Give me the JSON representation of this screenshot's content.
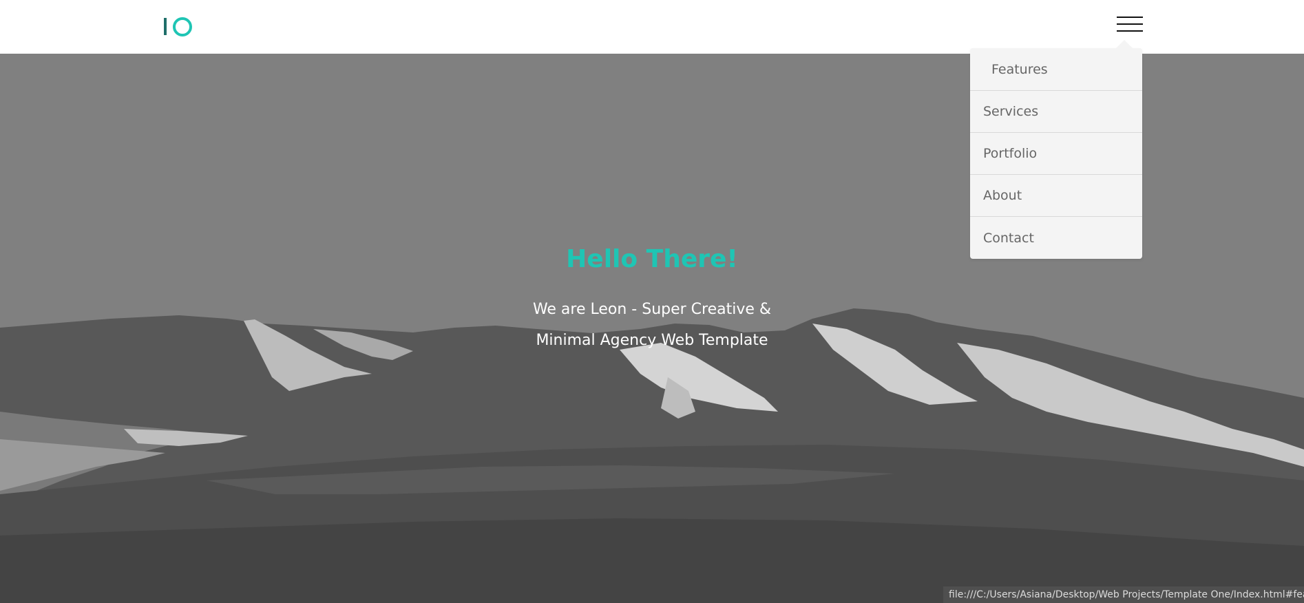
{
  "header": {
    "menu_icon": "hamburger-menu-icon"
  },
  "hero": {
    "title": "Hello There!",
    "subtitle_line1": "We are Leon - Super Creative &",
    "subtitle_line2": "Minimal Agency Web Template"
  },
  "nav_menu": {
    "items": [
      {
        "label": "Features"
      },
      {
        "label": "Services"
      },
      {
        "label": "Portfolio"
      },
      {
        "label": "About"
      },
      {
        "label": "Contact"
      }
    ]
  },
  "status_bar": {
    "url": "file:///C:/Users/Asiana/Desktop/Web Projects/Template One/Index.html#features"
  },
  "colors": {
    "accent": "#1fc5b4",
    "logo_dark": "#1f6f6a",
    "header_bg": "#ffffff",
    "menu_bg": "#f4f4f4",
    "menu_text": "#666666"
  }
}
